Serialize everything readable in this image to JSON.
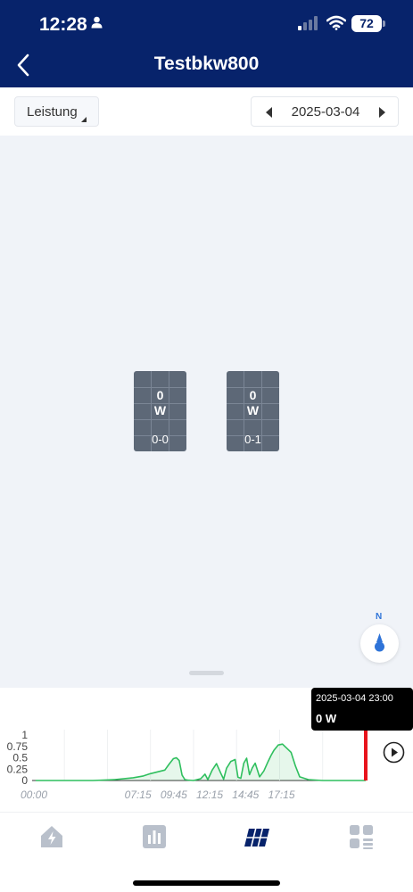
{
  "status_bar": {
    "time": "12:28",
    "battery": "72"
  },
  "header": {
    "title": "Testbkw800"
  },
  "toolbar": {
    "metric": "Leistung",
    "date": "2025-03-04"
  },
  "panels": [
    {
      "value": "0",
      "unit": "W",
      "id": "0-0"
    },
    {
      "value": "0",
      "unit": "W",
      "id": "0-1"
    }
  ],
  "compass": {
    "label": "N"
  },
  "chart_data": {
    "type": "area",
    "title": "",
    "xlabel": "",
    "ylabel": "",
    "y_ticks": [
      "1",
      "0.75",
      "0.5",
      "0.25",
      "0"
    ],
    "x_ticks": [
      "00:00",
      "07:15",
      "09:45",
      "12:15",
      "14:45",
      "17:15"
    ],
    "ylim": [
      0,
      1
    ],
    "line_color": "#2fbf5e",
    "marker_color": "#e8141d",
    "marker_time": "2025-03-04 23:00",
    "series": [
      {
        "x_hours": [
          0,
          4.0,
          5.5,
          6.8,
          7.5,
          8.0,
          8.5,
          9.0,
          9.3,
          9.6,
          9.8,
          10.0,
          10.2,
          10.4,
          10.6,
          11.0,
          11.5,
          11.8,
          12.0,
          12.3,
          12.6,
          12.9,
          13.1,
          13.3,
          13.6,
          13.9,
          14.1,
          14.3,
          14.5,
          14.7,
          14.9,
          15.1,
          15.3,
          15.6,
          15.9,
          16.2,
          16.4,
          16.6,
          16.9,
          17.2,
          17.5,
          17.8,
          18.1,
          18.4,
          19.0,
          20.0,
          23.0
        ],
        "y": [
          0,
          0,
          0.02,
          0.06,
          0.1,
          0.15,
          0.19,
          0.23,
          0.36,
          0.48,
          0.5,
          0.44,
          0.12,
          0.02,
          0.01,
          0.0,
          0.04,
          0.14,
          0.02,
          0.23,
          0.37,
          0.16,
          0.03,
          0.27,
          0.42,
          0.46,
          0.07,
          0.05,
          0.38,
          0.49,
          0.13,
          0.28,
          0.38,
          0.08,
          0.21,
          0.42,
          0.55,
          0.66,
          0.78,
          0.8,
          0.71,
          0.62,
          0.32,
          0.08,
          0.02,
          0,
          0
        ]
      }
    ],
    "tooltip": {
      "time": "2025-03-04 23:00",
      "value": "0 W"
    }
  },
  "nav": [
    {
      "name": "overview",
      "icon": "house-lightning-icon"
    },
    {
      "name": "statistics",
      "icon": "bar-chart-icon"
    },
    {
      "name": "layout",
      "icon": "solar-panel-icon"
    },
    {
      "name": "more",
      "icon": "grid-menu-icon"
    }
  ],
  "colors": {
    "header": "#07236b",
    "accent": "#2e73d8",
    "active_nav": "#07236b",
    "inactive_nav": "#b9c0cb"
  }
}
